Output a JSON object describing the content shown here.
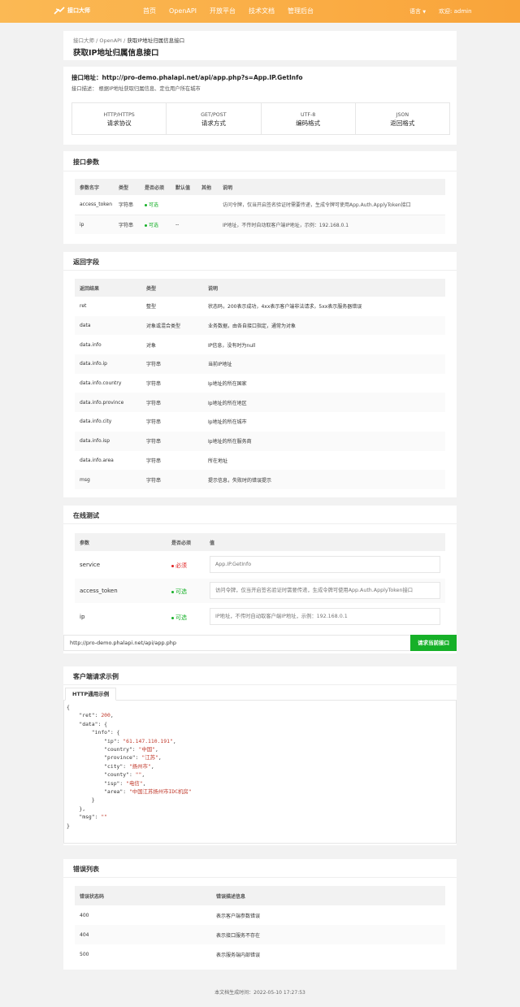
{
  "header": {
    "logo_text": "接口大师",
    "nav": [
      "首页",
      "OpenAPI",
      "开放平台",
      "技术文档",
      "管理后台"
    ],
    "lang": "语言",
    "user": "欢迎: admin"
  },
  "breadcrumb": [
    "接口大师",
    "OpenAPI",
    "获取IP地址归属信息接口"
  ],
  "page_title": "获取IP地址归属信息接口",
  "api": {
    "url_label": "接口地址：",
    "url": "http://pro-demo.phalapi.net/api/app.php?s=App.IP.GetInfo",
    "desc_label": "接口描述：",
    "desc": "根据IP地址获取归属信息、定位用户所在城市"
  },
  "specs": [
    {
      "top": "HTTP/HTTPS",
      "bottom": "请求协议"
    },
    {
      "top": "GET/POST",
      "bottom": "请求方式"
    },
    {
      "top": "UTF-8",
      "bottom": "编码格式"
    },
    {
      "top": "JSON",
      "bottom": "返回格式"
    }
  ],
  "params": {
    "title": "接口参数",
    "headers": [
      "参数名字",
      "类型",
      "是否必须",
      "默认值",
      "其他",
      "说明"
    ],
    "rows": [
      [
        "access_token",
        "字符串",
        "可选",
        "",
        "",
        "访问令牌，仅当开启签名验证时需要传递，生成令牌可使用App.Auth.ApplyToken接口"
      ],
      [
        "ip",
        "字符串",
        "可选",
        "--",
        "",
        "IP地址，不传时自动取客户端IP地址，示例：192.168.0.1"
      ]
    ]
  },
  "returns": {
    "title": "返回字段",
    "headers": [
      "返回结果",
      "类型",
      "说明"
    ],
    "rows": [
      [
        "ret",
        "整型",
        "状态码，200表示成功，4xx表示客户端非法请求，5xx表示服务器错误"
      ],
      [
        "data",
        "对象或混合类型",
        "业务数据，由各自接口指定，通常为对象"
      ],
      [
        "data.info",
        "对象",
        "IP信息，没有时为null"
      ],
      [
        "data.info.ip",
        "字符串",
        "当前IP地址"
      ],
      [
        "data.info.country",
        "字符串",
        "Ip地址的所在国家"
      ],
      [
        "data.info.province",
        "字符串",
        "Ip地址的所在地区"
      ],
      [
        "data.info.city",
        "字符串",
        "Ip地址的所在城市"
      ],
      [
        "data.info.isp",
        "字符串",
        "Ip地址的所在服务商"
      ],
      [
        "data.info.area",
        "字符串",
        "所在地址"
      ],
      [
        "msg",
        "字符串",
        "提示信息，失败时的错误提示"
      ]
    ]
  },
  "test": {
    "title": "在线测试",
    "headers": [
      "参数",
      "是否必须",
      "值"
    ],
    "rows": [
      {
        "name": "service",
        "req": "必须",
        "placeholder": "App.IP.GetInfo"
      },
      {
        "name": "access_token",
        "req": "可选",
        "placeholder": "访问令牌，仅当开启签名验证时需要传递，生成令牌可使用App.Auth.ApplyToken接口"
      },
      {
        "name": "ip",
        "req": "可选",
        "placeholder": "IP地址，不传时自动取客户端IP地址，示例：192.168.0.1"
      }
    ],
    "request_url": "http://pro-demo.phalapi.net/api/app.php",
    "submit": "请求当前接口"
  },
  "example": {
    "title": "客户端请求示例",
    "tab": "HTTP通用示例",
    "code": {
      "ret": "200",
      "ip": "\"61.147.110.191\"",
      "country": "\"中国\"",
      "province": "\"江苏\"",
      "city": "\"扬州市\"",
      "county": "\"\"",
      "isp": "\"电信\"",
      "area": "\"中国江苏扬州市IDC机房\"",
      "msg": "\"\""
    }
  },
  "errors": {
    "title": "错误列表",
    "headers": [
      "错误状态码",
      "错误描述信息"
    ],
    "rows": [
      [
        "400",
        "表示客户端参数错误"
      ],
      [
        "404",
        "表示接口服务不存在"
      ],
      [
        "500",
        "表示服务端内部错误"
      ]
    ]
  },
  "footer": "本文档生成时间：2022-05-10 17:27:53",
  "colors": {
    "header": "#f9a43a",
    "accent": "#16b028",
    "required": "#e02020"
  }
}
